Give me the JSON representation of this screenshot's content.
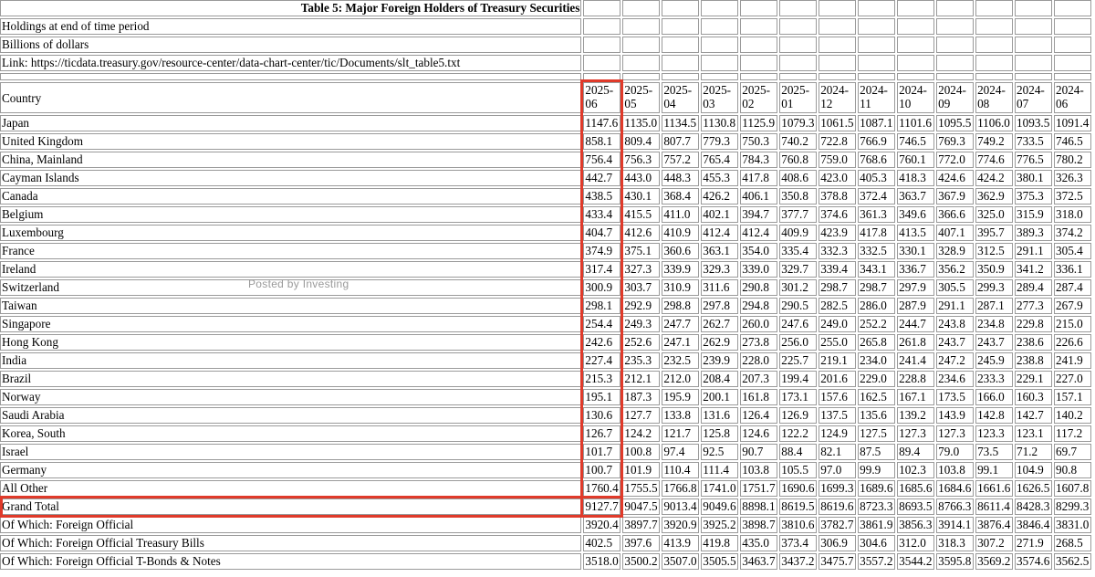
{
  "title": "Table 5: Major Foreign Holders of Treasury Securities",
  "notes": [
    "Holdings at end of time period",
    "Billions of dollars",
    "Link: https://ticdata.treasury.gov/resource-center/data-chart-center/tic/Documents/slt_table5.txt"
  ],
  "header": {
    "country_label": "Country",
    "periods": [
      "2025-06",
      "2025-05",
      "2025-04",
      "2025-03",
      "2025-02",
      "2025-01",
      "2024-12",
      "2024-11",
      "2024-10",
      "2024-09",
      "2024-08",
      "2024-07",
      "2024-06"
    ]
  },
  "rows": [
    {
      "name": "Japan",
      "values": [
        "1147.6",
        "1135.0",
        "1134.5",
        "1130.8",
        "1125.9",
        "1079.3",
        "1061.5",
        "1087.1",
        "1101.6",
        "1095.5",
        "1106.0",
        "1093.5",
        "1091.4"
      ]
    },
    {
      "name": "United Kingdom",
      "values": [
        "858.1",
        "809.4",
        "807.7",
        "779.3",
        "750.3",
        "740.2",
        "722.8",
        "766.9",
        "746.5",
        "769.3",
        "749.2",
        "733.5",
        "746.5"
      ]
    },
    {
      "name": "China, Mainland",
      "values": [
        "756.4",
        "756.3",
        "757.2",
        "765.4",
        "784.3",
        "760.8",
        "759.0",
        "768.6",
        "760.1",
        "772.0",
        "774.6",
        "776.5",
        "780.2"
      ]
    },
    {
      "name": "Cayman Islands",
      "values": [
        "442.7",
        "443.0",
        "448.3",
        "455.3",
        "417.8",
        "408.6",
        "423.0",
        "405.3",
        "418.3",
        "424.6",
        "424.2",
        "380.1",
        "326.3"
      ]
    },
    {
      "name": "Canada",
      "values": [
        "438.5",
        "430.1",
        "368.4",
        "426.2",
        "406.1",
        "350.8",
        "378.8",
        "372.4",
        "363.7",
        "367.9",
        "362.9",
        "375.3",
        "372.5"
      ]
    },
    {
      "name": "Belgium",
      "values": [
        "433.4",
        "415.5",
        "411.0",
        "402.1",
        "394.7",
        "377.7",
        "374.6",
        "361.3",
        "349.6",
        "366.6",
        "325.0",
        "315.9",
        "318.0"
      ]
    },
    {
      "name": "Luxembourg",
      "values": [
        "404.7",
        "412.6",
        "410.9",
        "412.4",
        "412.4",
        "409.9",
        "423.9",
        "417.8",
        "413.5",
        "407.1",
        "395.7",
        "389.3",
        "374.2"
      ]
    },
    {
      "name": "France",
      "values": [
        "374.9",
        "375.1",
        "360.6",
        "363.1",
        "354.0",
        "335.4",
        "332.3",
        "332.5",
        "330.1",
        "328.9",
        "312.5",
        "291.1",
        "305.4"
      ]
    },
    {
      "name": "Ireland",
      "values": [
        "317.4",
        "327.3",
        "339.9",
        "329.3",
        "339.0",
        "329.7",
        "339.4",
        "343.1",
        "336.7",
        "356.2",
        "350.9",
        "341.2",
        "336.1"
      ]
    },
    {
      "name": "Switzerland",
      "values": [
        "300.9",
        "303.7",
        "310.9",
        "311.6",
        "290.8",
        "301.2",
        "298.7",
        "298.7",
        "297.9",
        "305.5",
        "299.3",
        "289.4",
        "287.4"
      ]
    },
    {
      "name": "Taiwan",
      "values": [
        "298.1",
        "292.9",
        "298.8",
        "297.8",
        "294.8",
        "290.5",
        "282.5",
        "286.0",
        "287.9",
        "291.1",
        "287.1",
        "277.3",
        "267.9"
      ]
    },
    {
      "name": "Singapore",
      "values": [
        "254.4",
        "249.3",
        "247.7",
        "262.7",
        "260.0",
        "247.6",
        "249.0",
        "252.2",
        "244.7",
        "243.8",
        "234.8",
        "229.8",
        "215.0"
      ]
    },
    {
      "name": "Hong Kong",
      "values": [
        "242.6",
        "252.6",
        "247.1",
        "262.9",
        "273.8",
        "256.0",
        "255.0",
        "265.8",
        "261.8",
        "243.7",
        "243.7",
        "238.6",
        "226.6"
      ]
    },
    {
      "name": "India",
      "values": [
        "227.4",
        "235.3",
        "232.5",
        "239.9",
        "228.0",
        "225.7",
        "219.1",
        "234.0",
        "241.4",
        "247.2",
        "245.9",
        "238.8",
        "241.9"
      ]
    },
    {
      "name": "Brazil",
      "values": [
        "215.3",
        "212.1",
        "212.0",
        "208.4",
        "207.3",
        "199.4",
        "201.6",
        "229.0",
        "228.8",
        "234.6",
        "233.3",
        "229.1",
        "227.0"
      ]
    },
    {
      "name": "Norway",
      "values": [
        "195.1",
        "187.3",
        "195.9",
        "200.1",
        "161.8",
        "173.1",
        "157.6",
        "162.5",
        "167.1",
        "173.5",
        "166.0",
        "160.3",
        "157.1"
      ]
    },
    {
      "name": "Saudi Arabia",
      "values": [
        "130.6",
        "127.7",
        "133.8",
        "131.6",
        "126.4",
        "126.9",
        "137.5",
        "135.6",
        "139.2",
        "143.9",
        "142.8",
        "142.7",
        "140.2"
      ]
    },
    {
      "name": "Korea, South",
      "values": [
        "126.7",
        "124.2",
        "121.7",
        "125.8",
        "124.6",
        "122.2",
        "124.9",
        "127.5",
        "127.3",
        "127.3",
        "123.3",
        "123.1",
        "117.2"
      ]
    },
    {
      "name": "Israel",
      "values": [
        "101.7",
        "100.8",
        "97.4",
        "92.5",
        "90.7",
        "88.4",
        "82.1",
        "87.5",
        "89.4",
        "79.0",
        "73.5",
        "71.2",
        "69.7"
      ]
    },
    {
      "name": "Germany",
      "values": [
        "100.7",
        "101.9",
        "110.4",
        "111.4",
        "103.8",
        "105.5",
        "97.0",
        "99.9",
        "102.3",
        "103.8",
        "99.1",
        "104.9",
        "90.8"
      ]
    },
    {
      "name": "All Other",
      "values": [
        "1760.4",
        "1755.5",
        "1766.8",
        "1741.0",
        "1751.7",
        "1690.6",
        "1699.3",
        "1689.6",
        "1685.6",
        "1684.6",
        "1661.6",
        "1626.5",
        "1607.8"
      ]
    },
    {
      "name": "Grand Total",
      "values": [
        "9127.7",
        "9047.5",
        "9013.4",
        "9049.6",
        "8898.1",
        "8619.5",
        "8619.6",
        "8723.3",
        "8693.5",
        "8766.3",
        "8611.4",
        "8428.3",
        "8299.3"
      ]
    },
    {
      "name": "Of Which: Foreign Official",
      "values": [
        "3920.4",
        "3897.7",
        "3920.9",
        "3925.2",
        "3898.7",
        "3810.6",
        "3782.7",
        "3861.9",
        "3856.3",
        "3914.1",
        "3876.4",
        "3846.4",
        "3831.0"
      ]
    },
    {
      "name": "Of Which: Foreign Official Treasury Bills",
      "values": [
        "402.5",
        "397.6",
        "413.9",
        "419.8",
        "435.0",
        "373.4",
        "306.9",
        "304.6",
        "312.0",
        "318.3",
        "307.2",
        "271.9",
        "268.5"
      ]
    },
    {
      "name": "Of Which: Foreign Official T-Bonds & Notes",
      "values": [
        "3518.0",
        "3500.2",
        "3507.0",
        "3505.5",
        "3463.7",
        "3437.2",
        "3475.7",
        "3557.2",
        "3544.2",
        "3595.8",
        "3569.2",
        "3574.6",
        "3562.5"
      ]
    }
  ],
  "watermark": "Posted by Investing",
  "accent_color": "#e03a2a"
}
